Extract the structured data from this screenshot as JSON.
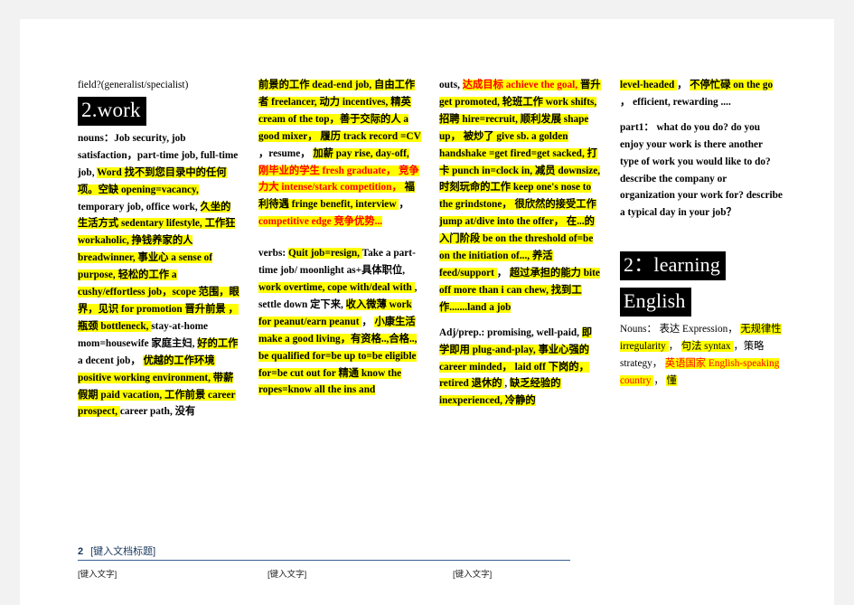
{
  "document": {
    "type": "word-document",
    "accent_color": "#365f91",
    "highlight_color": "#ffff00",
    "red_color": "#ff0000",
    "heading_box_bg": "#000000",
    "heading_box_fg": "#ffffff"
  },
  "columns": [
    {
      "id": "column-1",
      "top_line": "field?(generalist/specialist)",
      "heading": "2.work",
      "blocks": [
        {
          "id": "nouns-block",
          "runs": [
            {
              "t": "nouns：Job security, job satisfaction，part-time job, full-time job,",
              "hl": false,
              "red": false
            },
            {
              "t": "Word  找不到您目录中的任何项。空缺 opening=vacancy,",
              "hl": true,
              "red": false
            },
            {
              "t": " temporary job, office work, ",
              "hl": false,
              "red": false
            },
            {
              "t": "久坐的生活方式 sedentary lifestyle,",
              "hl": true,
              "red": false
            },
            {
              "t": "工作狂 workaholic,",
              "hl": true,
              "red": false
            },
            {
              "t": "挣钱养家的人 breadwinner, 事业心 a sense of purpose,",
              "hl": true,
              "red": false
            },
            {
              "t": "轻松的工作 a cushy/effortless job，scope 范围，眼界，见识 for promotion 晋升前景",
              "hl": true,
              "red": false
            },
            {
              "t": "，瓶颈 bottleneck,",
              "hl": true,
              "red": false
            },
            {
              "t": " stay-at-home mom=housewife 家庭主妇,",
              "hl": false,
              "red": false
            },
            {
              "t": "好的工作 ",
              "hl": true,
              "red": false
            },
            {
              "t": "a decent job，",
              "hl": false,
              "red": false
            },
            {
              "t": "优越的工作环境 positive working environment,",
              "hl": true,
              "red": false
            },
            {
              "t": " 带薪假期 paid vacation,",
              "hl": true,
              "red": false
            },
            {
              "t": " 工作前景 career prospect,",
              "hl": true,
              "red": false
            },
            {
              "t": " career path,  没有",
              "hl": false,
              "red": false
            }
          ]
        }
      ]
    },
    {
      "id": "column-2",
      "blocks": [
        {
          "id": "nouns-continued",
          "runs": [
            {
              "t": "前景的工作 dead-end job, 自由工作者 freelancer, 动力 incentives,",
              "hl": true,
              "red": false
            },
            {
              "t": " 精英 cream of the top，善于交际的人 a good mixer，",
              "hl": true,
              "red": false
            },
            {
              "t": " 履历 track record =CV",
              "hl": true,
              "red": false
            },
            {
              "t": "，resume，",
              "hl": false,
              "red": false
            },
            {
              "t": "加薪 pay rise, day-off,",
              "hl": true,
              "red": false
            },
            {
              "t": " 刚毕业的学生 fresh graduate，",
              "hl": true,
              "red": true
            },
            {
              "t": " 竞争力大 intense/stark competition，",
              "hl": true,
              "red": true
            },
            {
              "t": " 福利待遇 fringe benefit, interview",
              "hl": true,
              "red": false
            },
            {
              "t": "，",
              "hl": false,
              "red": false
            },
            {
              "t": "competitive edge 竞争优势...",
              "hl": true,
              "red": true
            }
          ]
        },
        {
          "id": "verbs-block",
          "runs": [
            {
              "t": "verbs: ",
              "hl": false,
              "red": false
            },
            {
              "t": "Quit job=resign,",
              "hl": true,
              "red": false
            },
            {
              "t": " Take a part-time job/ moonlight as+具体职位,",
              "hl": false,
              "red": false
            },
            {
              "t": " work overtime, cope with/deal with",
              "hl": true,
              "red": false
            },
            {
              "t": ", settle down 定下来, ",
              "hl": false,
              "red": false
            },
            {
              "t": "收入微薄 work for peanut/earn peanut",
              "hl": true,
              "red": false
            },
            {
              "t": "，",
              "hl": false,
              "red": false
            },
            {
              "t": "小康生活 make a good living，有资格..,合格.., be qualified for=be up to=be eligible for=be cut out for",
              "hl": true,
              "red": false
            },
            {
              "t": " 精通 know the ropes=know all the ins and",
              "hl": true,
              "red": false
            }
          ]
        }
      ]
    },
    {
      "id": "column-3",
      "blocks": [
        {
          "id": "verbs-continued",
          "runs": [
            {
              "t": "outs, ",
              "hl": false,
              "red": false
            },
            {
              "t": "达成目标 achieve the goal,",
              "hl": true,
              "red": true
            },
            {
              "t": " 晋升 get promoted, 轮班工作 work shifts,",
              "hl": true,
              "red": false
            },
            {
              "t": " 招聘 hire=recruit,",
              "hl": true,
              "red": false
            },
            {
              "t": " 顺利发展 shape up，",
              "hl": true,
              "red": false
            },
            {
              "t": " 被炒了 give sb. a golden handshake =get fired=get sacked,",
              "hl": true,
              "red": false
            },
            {
              "t": " 打卡 punch in=clock in,",
              "hl": true,
              "red": false
            },
            {
              "t": " 减员 downsize,",
              "hl": true,
              "red": false
            },
            {
              "t": " 时刻玩命的工作 keep one's nose to the grindstone，",
              "hl": true,
              "red": false
            },
            {
              "t": " 很欣然的接受工作 jump at/dive into the offer，",
              "hl": true,
              "red": false
            },
            {
              "t": "在...的入门阶段 be on the threshold of=be on the initiation of...,",
              "hl": true,
              "red": false
            },
            {
              "t": " 养活 feed/support",
              "hl": true,
              "red": false
            },
            {
              "t": "，",
              "hl": false,
              "red": false
            },
            {
              "t": "超过承担的能力 bite off more than i can chew, ",
              "hl": true,
              "red": false
            },
            {
              "t": "找到工作.......land a job",
              "hl": true,
              "red": false
            }
          ]
        },
        {
          "id": "adj-prep-block",
          "runs": [
            {
              "t": "Adj/prep.: promising, well-paid, ",
              "hl": false,
              "red": false
            },
            {
              "t": "即学即用 plug-and-play,",
              "hl": true,
              "red": false
            },
            {
              "t": " 事业心强的 career minded，",
              "hl": true,
              "red": false
            },
            {
              "t": " laid off 下岗的，",
              "hl": true,
              "red": false
            },
            {
              "t": " retired 退休的",
              "hl": true,
              "red": false
            },
            {
              "t": ",",
              "hl": false,
              "red": false
            },
            {
              "t": "缺乏经验的 inexperienced,",
              "hl": true,
              "red": false
            },
            {
              "t": " 冷静的",
              "hl": true,
              "red": false
            }
          ]
        }
      ]
    },
    {
      "id": "column-4",
      "blocks": [
        {
          "id": "adj-continued",
          "runs": [
            {
              "t": "level-headed",
              "hl": true,
              "red": false
            },
            {
              "t": "，",
              "hl": false,
              "red": false
            },
            {
              "t": "不停忙碌 on the go",
              "hl": true,
              "red": false
            },
            {
              "t": "， efficient, rewarding ....",
              "hl": false,
              "red": false
            }
          ]
        },
        {
          "id": "part1-block",
          "runs": [
            {
              "t": "part1：",
              "hl": false,
              "red": false
            },
            {
              "t": "what do you do?",
              "hl": false,
              "red": false
            },
            {
              "t": "do you enjoy your work",
              "hl": false,
              "red": false
            },
            {
              "t": "is there another type of work you would like to do?",
              "hl": false,
              "red": false
            },
            {
              "t": "describe the company or organization your work for?",
              "hl": false,
              "red": false
            },
            {
              "t": "describe a typical day in your job？",
              "hl": false,
              "red": false
            }
          ]
        }
      ],
      "heading_line1": "2：learning",
      "heading_line2": "English",
      "after_heading": {
        "id": "learning-nouns",
        "runs": [
          {
            "t": "Nouns：",
            "hl": false,
            "red": false
          },
          {
            "t": "表达 Expression，",
            "hl": false,
            "red": false
          },
          {
            "t": "无规律性 irregularity",
            "hl": true,
            "red": false
          },
          {
            "t": "，",
            "hl": false,
            "red": false
          },
          {
            "t": "句法 syntax",
            "hl": true,
            "red": false
          },
          {
            "t": "，策略 strategy，",
            "hl": false,
            "red": false
          },
          {
            "t": "英语国家 English-speaking country",
            "hl": true,
            "red": true
          },
          {
            "t": "，",
            "hl": false,
            "red": false
          },
          {
            "t": "懂",
            "hl": true,
            "red": false
          }
        ]
      }
    }
  ],
  "footer": {
    "page_number": "2",
    "doc_title_placeholder": "[键入文档标题]",
    "field_1": "[键入文字]",
    "field_2": "[键入文字]",
    "field_3": "[键入文字]"
  }
}
